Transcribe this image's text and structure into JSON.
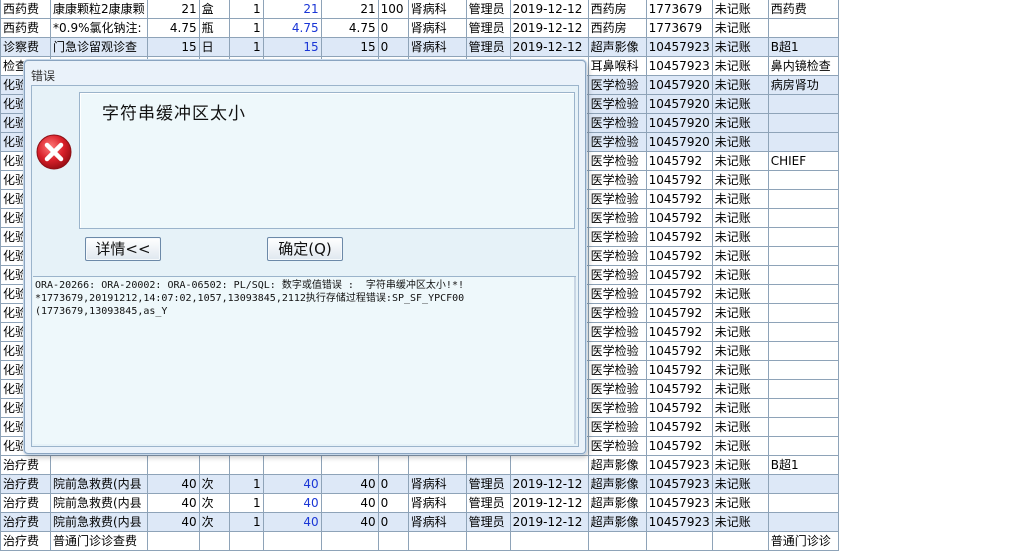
{
  "grid": {
    "rows": [
      {
        "type": "西药费",
        "item": "康康颗粒2康康颗",
        "qty": "21",
        "unit": "盒",
        "n": "1",
        "price": "21",
        "amount": "21",
        "pct": "100",
        "dept": "肾病科",
        "operator": "管理员",
        "date": "2019-12-12",
        "exec": "西药房",
        "code": "1773679",
        "status": "未记账",
        "note": "西药费",
        "alt": false
      },
      {
        "type": "西药费",
        "item": "*0.9%氯化钠注:",
        "qty": "4.75",
        "unit": "瓶",
        "n": "1",
        "price": "4.75",
        "amount": "4.75",
        "pct": "0",
        "dept": "肾病科",
        "operator": "管理员",
        "date": "2019-12-12",
        "exec": "西药房",
        "code": "1773679",
        "status": "未记账",
        "note": "",
        "alt": false
      },
      {
        "type": "诊察费",
        "item": "门急诊留观诊查",
        "qty": "15",
        "unit": "日",
        "n": "1",
        "price": "15",
        "amount": "15",
        "pct": "0",
        "dept": "肾病科",
        "operator": "管理员",
        "date": "2019-12-12",
        "exec": "超声影像",
        "code": "10457923",
        "status": "未记账",
        "note": "B超1",
        "alt": true
      },
      {
        "type": "检查",
        "item": "",
        "qty": "",
        "unit": "",
        "n": "",
        "price": "",
        "amount": "",
        "pct": "",
        "dept": "",
        "operator": "",
        "date": "",
        "exec": "耳鼻喉科",
        "code": "10457923",
        "status": "未记账",
        "note": "鼻内镜检查",
        "alt": false
      },
      {
        "type": "化验",
        "item": "",
        "qty": "",
        "unit": "",
        "n": "",
        "price": "",
        "amount": "",
        "pct": "",
        "dept": "",
        "operator": "",
        "date": "",
        "exec": "医学检验",
        "code": "10457920",
        "status": "未记账",
        "note": "病房肾功",
        "alt": true
      },
      {
        "type": "化验",
        "item": "",
        "qty": "",
        "unit": "",
        "n": "",
        "price": "",
        "amount": "",
        "pct": "",
        "dept": "",
        "operator": "",
        "date": "",
        "exec": "医学检验",
        "code": "10457920",
        "status": "未记账",
        "note": "",
        "alt": true
      },
      {
        "type": "化验",
        "item": "",
        "qty": "",
        "unit": "",
        "n": "",
        "price": "",
        "amount": "",
        "pct": "",
        "dept": "",
        "operator": "",
        "date": "",
        "exec": "医学检验",
        "code": "10457920",
        "status": "未记账",
        "note": "",
        "alt": true
      },
      {
        "type": "化验",
        "item": "",
        "qty": "",
        "unit": "",
        "n": "",
        "price": "",
        "amount": "",
        "pct": "",
        "dept": "",
        "operator": "",
        "date": "",
        "exec": "医学检验",
        "code": "10457920",
        "status": "未记账",
        "note": "",
        "alt": true
      },
      {
        "type": "化验",
        "item": "",
        "qty": "",
        "unit": "",
        "n": "",
        "price": "",
        "amount": "",
        "pct": "",
        "dept": "",
        "operator": "",
        "date": "",
        "exec": "医学检验",
        "code": "1045792",
        "status": "未记账",
        "note": "CHIEF",
        "alt": false
      },
      {
        "type": "化验",
        "item": "",
        "qty": "",
        "unit": "",
        "n": "",
        "price": "",
        "amount": "",
        "pct": "",
        "dept": "",
        "operator": "",
        "date": "",
        "exec": "医学检验",
        "code": "1045792",
        "status": "未记账",
        "note": "",
        "alt": false
      },
      {
        "type": "化验",
        "item": "",
        "qty": "",
        "unit": "",
        "n": "",
        "price": "",
        "amount": "",
        "pct": "",
        "dept": "",
        "operator": "",
        "date": "",
        "exec": "医学检验",
        "code": "1045792",
        "status": "未记账",
        "note": "",
        "alt": false
      },
      {
        "type": "化验",
        "item": "",
        "qty": "",
        "unit": "",
        "n": "",
        "price": "",
        "amount": "",
        "pct": "",
        "dept": "",
        "operator": "",
        "date": "",
        "exec": "医学检验",
        "code": "1045792",
        "status": "未记账",
        "note": "",
        "alt": false
      },
      {
        "type": "化验",
        "item": "",
        "qty": "",
        "unit": "",
        "n": "",
        "price": "",
        "amount": "",
        "pct": "",
        "dept": "",
        "operator": "",
        "date": "",
        "exec": "医学检验",
        "code": "1045792",
        "status": "未记账",
        "note": "",
        "alt": false
      },
      {
        "type": "化验",
        "item": "",
        "qty": "",
        "unit": "",
        "n": "",
        "price": "",
        "amount": "",
        "pct": "",
        "dept": "",
        "operator": "",
        "date": "",
        "exec": "医学检验",
        "code": "1045792",
        "status": "未记账",
        "note": "",
        "alt": false
      },
      {
        "type": "化验",
        "item": "",
        "qty": "",
        "unit": "",
        "n": "",
        "price": "",
        "amount": "",
        "pct": "",
        "dept": "",
        "operator": "",
        "date": "",
        "exec": "医学检验",
        "code": "1045792",
        "status": "未记账",
        "note": "",
        "alt": false
      },
      {
        "type": "化验",
        "item": "",
        "qty": "",
        "unit": "",
        "n": "",
        "price": "",
        "amount": "",
        "pct": "",
        "dept": "",
        "operator": "",
        "date": "",
        "exec": "医学检验",
        "code": "1045792",
        "status": "未记账",
        "note": "",
        "alt": false
      },
      {
        "type": "化验",
        "item": "",
        "qty": "",
        "unit": "",
        "n": "",
        "price": "",
        "amount": "",
        "pct": "",
        "dept": "",
        "operator": "",
        "date": "",
        "exec": "医学检验",
        "code": "1045792",
        "status": "未记账",
        "note": "",
        "alt": false
      },
      {
        "type": "化验",
        "item": "",
        "qty": "",
        "unit": "",
        "n": "",
        "price": "",
        "amount": "",
        "pct": "",
        "dept": "",
        "operator": "",
        "date": "",
        "exec": "医学检验",
        "code": "1045792",
        "status": "未记账",
        "note": "",
        "alt": false
      },
      {
        "type": "化验",
        "item": "",
        "qty": "",
        "unit": "",
        "n": "",
        "price": "",
        "amount": "",
        "pct": "",
        "dept": "",
        "operator": "",
        "date": "",
        "exec": "医学检验",
        "code": "1045792",
        "status": "未记账",
        "note": "",
        "alt": false
      },
      {
        "type": "化验",
        "item": "",
        "qty": "",
        "unit": "",
        "n": "",
        "price": "",
        "amount": "",
        "pct": "",
        "dept": "",
        "operator": "",
        "date": "",
        "exec": "医学检验",
        "code": "1045792",
        "status": "未记账",
        "note": "",
        "alt": false
      },
      {
        "type": "化验",
        "item": "",
        "qty": "",
        "unit": "",
        "n": "",
        "price": "",
        "amount": "",
        "pct": "",
        "dept": "",
        "operator": "",
        "date": "",
        "exec": "医学检验",
        "code": "1045792",
        "status": "未记账",
        "note": "",
        "alt": false
      },
      {
        "type": "化验",
        "item": "",
        "qty": "",
        "unit": "",
        "n": "",
        "price": "",
        "amount": "",
        "pct": "",
        "dept": "",
        "operator": "",
        "date": "",
        "exec": "医学检验",
        "code": "1045792",
        "status": "未记账",
        "note": "",
        "alt": false
      },
      {
        "type": "化验",
        "item": "",
        "qty": "",
        "unit": "",
        "n": "",
        "price": "",
        "amount": "",
        "pct": "",
        "dept": "",
        "operator": "",
        "date": "",
        "exec": "医学检验",
        "code": "1045792",
        "status": "未记账",
        "note": "",
        "alt": false
      },
      {
        "type": "化验",
        "item": "",
        "qty": "",
        "unit": "",
        "n": "",
        "price": "",
        "amount": "",
        "pct": "",
        "dept": "",
        "operator": "",
        "date": "",
        "exec": "医学检验",
        "code": "1045792",
        "status": "未记账",
        "note": "",
        "alt": false
      },
      {
        "type": "治疗费",
        "item": "",
        "qty": "",
        "unit": "",
        "n": "",
        "price": "",
        "amount": "",
        "pct": "",
        "dept": "",
        "operator": "",
        "date": "",
        "exec": "超声影像",
        "code": "10457923",
        "status": "未记账",
        "note": "B超1",
        "alt": false
      },
      {
        "type": "治疗费",
        "item": "院前急救费(内县",
        "qty": "40",
        "unit": "次",
        "n": "1",
        "price": "40",
        "amount": "40",
        "pct": "0",
        "dept": "肾病科",
        "operator": "管理员",
        "date": "2019-12-12",
        "exec": "超声影像",
        "code": "10457923",
        "status": "未记账",
        "note": "",
        "alt": true
      },
      {
        "type": "治疗费",
        "item": "院前急救费(内县",
        "qty": "40",
        "unit": "次",
        "n": "1",
        "price": "40",
        "amount": "40",
        "pct": "0",
        "dept": "肾病科",
        "operator": "管理员",
        "date": "2019-12-12",
        "exec": "超声影像",
        "code": "10457923",
        "status": "未记账",
        "note": "",
        "alt": false
      },
      {
        "type": "治疗费",
        "item": "院前急救费(内县",
        "qty": "40",
        "unit": "次",
        "n": "1",
        "price": "40",
        "amount": "40",
        "pct": "0",
        "dept": "肾病科",
        "operator": "管理员",
        "date": "2019-12-12",
        "exec": "超声影像",
        "code": "10457923",
        "status": "未记账",
        "note": "",
        "alt": true
      },
      {
        "type": "治疗费",
        "item": "普通门诊诊查费",
        "qty": "",
        "unit": "",
        "n": "",
        "price": "",
        "amount": "",
        "pct": "",
        "dept": "",
        "operator": "",
        "date": "",
        "exec": "",
        "code": "",
        "status": "",
        "note": "普通门诊诊",
        "alt": false
      }
    ]
  },
  "dialog": {
    "title": "错误",
    "message": "字符串缓冲区太小",
    "details_button": "详情<<",
    "ok_button": "确定(Q)",
    "details": "ORA-20266: ORA-20002: ORA-06502: PL/SQL: 数字或值错误 :  字符串缓冲区太小!*!\n*1773679,20191212,14:07:02,1057,13093845,2112执行存储过程错误:SP_SF_YPCF00\n(1773679,13093845,as_Y",
    "icon": "error-icon",
    "error_color": "#d9202a"
  }
}
